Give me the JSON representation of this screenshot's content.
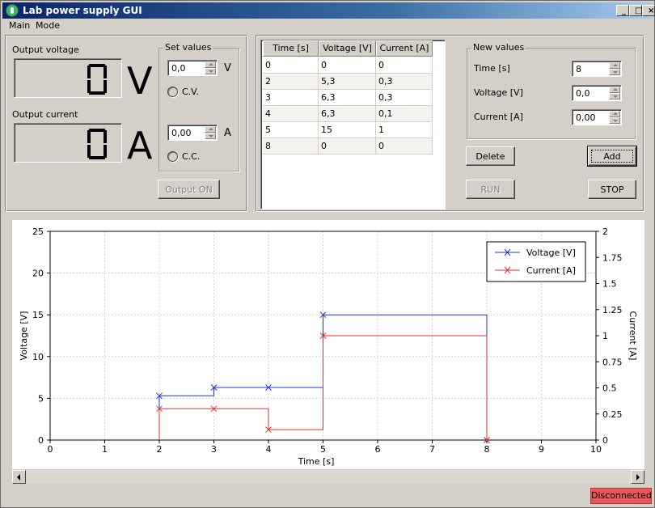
{
  "window": {
    "title": "Lab power supply GUI",
    "minimize": "_",
    "maximize": "□",
    "close": "×"
  },
  "menu": {
    "items": [
      "Main",
      "Mode"
    ]
  },
  "output": {
    "voltage_label": "Output voltage",
    "current_label": "Output current",
    "voltage_value": "0",
    "current_value": "0",
    "voltage_unit": "V",
    "current_unit": "A"
  },
  "set_values": {
    "title": "Set values",
    "voltage": "0,0",
    "voltage_unit": "V",
    "cv_label": "C.V.",
    "current": "0,00",
    "current_unit": "A",
    "cc_label": "C.C.",
    "output_button": "Output ON"
  },
  "table": {
    "headers": [
      "Time [s]",
      "Voltage [V]",
      "Current [A]"
    ],
    "rows": [
      [
        "0",
        "0",
        "0"
      ],
      [
        "2",
        "5,3",
        "0,3"
      ],
      [
        "3",
        "6,3",
        "0,3"
      ],
      [
        "4",
        "6,3",
        "0,1"
      ],
      [
        "5",
        "15",
        "1"
      ],
      [
        "8",
        "0",
        "0"
      ]
    ]
  },
  "new_values": {
    "title": "New values",
    "time_label": "Time [s]",
    "time_value": "8",
    "voltage_label": "Voltage [V]",
    "voltage_value": "0,0",
    "current_label": "Current [A]",
    "current_value": "0,00",
    "delete_button": "Delete",
    "add_button": "Add",
    "run_button": "RUN",
    "stop_button": "STOP"
  },
  "colors": {
    "voltage": "#2233cc",
    "current": "#dd3333",
    "status_bg": "#e8575a"
  },
  "chart_data": {
    "type": "line",
    "step": true,
    "xlabel": "Time [s]",
    "ylabel": "Voltage [V]",
    "y2label": "Current [A]",
    "xlim": [
      0,
      10
    ],
    "ylim": [
      0,
      25
    ],
    "y2lim": [
      0,
      2
    ],
    "xticks": [
      "0",
      "1",
      "2",
      "3",
      "4",
      "5",
      "6",
      "7",
      "8",
      "9",
      "10"
    ],
    "yticks": [
      "0",
      "5",
      "10",
      "15",
      "20",
      "25"
    ],
    "y2ticks": [
      "0",
      "0.25",
      "0.5",
      "0.75",
      "1",
      "1.25",
      "1.5",
      "1.75",
      "2"
    ],
    "grid": true,
    "legend_position": "top-right",
    "series": [
      {
        "name": "Voltage [V]",
        "axis": "left",
        "x": [
          2,
          3,
          4,
          5,
          8
        ],
        "y": [
          5.3,
          6.3,
          6.3,
          15,
          0
        ]
      },
      {
        "name": "Current [A]",
        "axis": "right",
        "x": [
          2,
          3,
          4,
          5,
          8
        ],
        "y": [
          0.3,
          0.3,
          0.1,
          1,
          0
        ]
      }
    ]
  },
  "status": {
    "text": "Disconnected"
  }
}
